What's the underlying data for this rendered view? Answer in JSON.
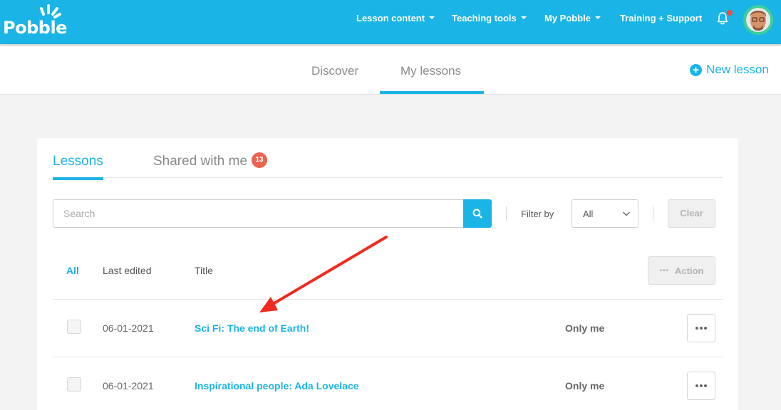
{
  "brand": {
    "name": "Pobble"
  },
  "nav": {
    "items": [
      {
        "label": "Lesson content"
      },
      {
        "label": "Teaching tools"
      },
      {
        "label": "My Pobble"
      },
      {
        "label": "Training + Support"
      }
    ]
  },
  "subnav": {
    "tabs": [
      {
        "label": "Discover"
      },
      {
        "label": "My lessons",
        "active": true
      }
    ],
    "new_lesson": "New lesson"
  },
  "panel": {
    "tabs": [
      {
        "label": "Lessons",
        "active": true
      },
      {
        "label": "Shared with me",
        "badge": "13"
      }
    ],
    "search": {
      "placeholder": "Search",
      "value": ""
    },
    "filter": {
      "label": "Filter by",
      "selected": "All"
    },
    "clear_label": "Clear",
    "table": {
      "headers": {
        "select_all": "All",
        "last_edited": "Last edited",
        "title": "Title"
      },
      "action_label": "Action",
      "rows": [
        {
          "date": "06-01-2021",
          "title": "Sci Fi: The end of Earth!",
          "sharing": "Only me"
        },
        {
          "date": "06-01-2021",
          "title": "Inspirational people: Ada Lovelace",
          "sharing": "Only me"
        }
      ]
    }
  },
  "colors": {
    "brand_blue": "#1ab4e6",
    "badge_red": "#ec6350",
    "annotation_arrow": "#f02a1e"
  },
  "icons": [
    "bell-icon",
    "search-icon",
    "plus-circle-icon",
    "chevron-down-icon",
    "more-dots-icon"
  ]
}
